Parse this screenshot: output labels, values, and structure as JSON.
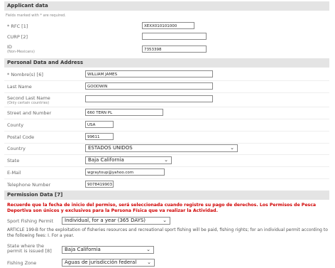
{
  "applicant": {
    "header": "Applicant data",
    "required_note": "Fields marked with * are required.",
    "rfc_label": "* RFC [1]",
    "rfc_value": "XEXX010101000",
    "curp_label": "CURP [2]",
    "curp_value": "",
    "id_label": "ID",
    "id_sublabel": "(Non-Mexicans)",
    "id_value": "7353398"
  },
  "personal": {
    "header": "Personal Data and Address",
    "name_label": "* Nombre(s) [6]",
    "name_value": "WILLIAM JAMES",
    "last_name_label": "Last Name",
    "last_name_value": "GOODWIN",
    "second_last_label": "Second Last Name",
    "second_last_sublabel": "(Only certain countries)",
    "second_last_value": "",
    "street_label": "Street and Number",
    "street_value": "660 TERN PL",
    "county_label": "County",
    "county_value": "USA",
    "postal_label": "Postal Code",
    "postal_value": "99611",
    "country_label": "Country",
    "country_value": "ESTADOS UNIDOS",
    "state_label": "State",
    "state_value": "Baja California",
    "email_label": "E-Mail",
    "email_value": "wgraytoup@yahoo.com",
    "phone_label": "Telephone Number",
    "phone_value": "9078419903"
  },
  "permission": {
    "header": "Permission Data [7]",
    "notice": "Recuerde que la fecha de inicio del permiso, será seleccionada cuando registre su pago de derechos. Los Permisos de Pesca Deportiva son únicos y exclusivos para la Persona Física que va realizar la Actividad.",
    "permit_label": "Sport Fishing Permit",
    "permit_value": "Individual, for a year (365 DAYS)",
    "article_text": "ARTICLE 199-B for the exploitation of fisheries resources and recreational sport fishing will be paid, fishing rights; for an individual permit according to the following fees: I. For a year.",
    "state_start_label_1": "State where the",
    "state_start_label_2": "permit is issued [8]",
    "state_start_value": "Baja California",
    "zone_label": "Fishing Zone",
    "zone_value": "Aguas de jurisdicción federal"
  }
}
